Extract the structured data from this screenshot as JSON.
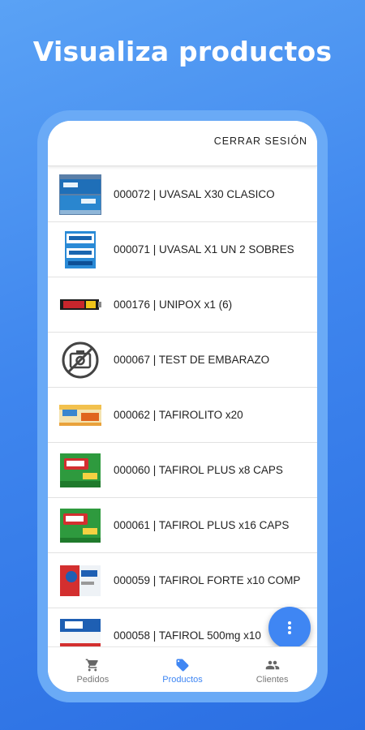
{
  "headline": "Visualiza productos",
  "appbar": {
    "logout_label": "CERRAR SESIÓN"
  },
  "products": [
    {
      "label": "000072 | UVASAL X30 CLASICO",
      "image": "uvasal-box"
    },
    {
      "label": "000071 | UVASAL X1 UN 2 SOBRES",
      "image": "uvasal-sachet"
    },
    {
      "label": "000176 | UNIPOX x1 (6)",
      "image": "unipox-tube"
    },
    {
      "label": "000067 | TEST DE EMBARAZO",
      "image": "no-photo-icon"
    },
    {
      "label": "000062 | TAFIROLITO x20",
      "image": "tafirolito-box"
    },
    {
      "label": "000060 | TAFIROL PLUS x8 CAPS",
      "image": "tafirol-plus-box"
    },
    {
      "label": "000061 | TAFIROL PLUS x16 CAPS",
      "image": "tafirol-plus-box"
    },
    {
      "label": "000059 | TAFIROL FORTE x10 COMP",
      "image": "tafirol-forte-box"
    },
    {
      "label": "000058 | TAFIROL 500mg x10",
      "image": "tafirol-500-box"
    }
  ],
  "fab": {
    "icon": "more-vert-icon"
  },
  "bottom_nav": [
    {
      "label": "Pedidos",
      "icon": "cart-icon",
      "active": false
    },
    {
      "label": "Productos",
      "icon": "tag-icon",
      "active": true
    },
    {
      "label": "Clientes",
      "icon": "people-icon",
      "active": false
    }
  ],
  "colors": {
    "accent": "#3f86f3",
    "background": "#4a8ff0"
  }
}
